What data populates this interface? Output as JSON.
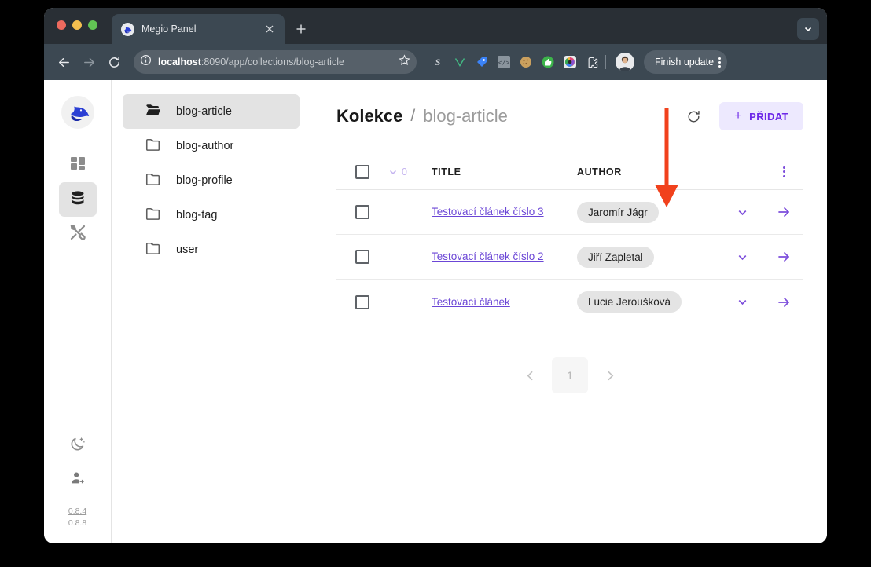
{
  "browser": {
    "tab": {
      "title": "Megio Panel",
      "favicon_icon": "shark-favicon",
      "close_icon": "close-icon"
    },
    "new_tab_label": "+",
    "tab_list_icon": "chevron-down-icon",
    "nav": {
      "back_icon": "arrow-back-icon",
      "forward_icon": "arrow-forward-icon",
      "reload_icon": "reload-icon"
    },
    "omnibox": {
      "info_icon": "info-circle-icon",
      "url_host": "localhost",
      "url_rest": ":8090/app/collections/blog-article",
      "bookmark_icon": "star-icon"
    },
    "extensions": [
      {
        "name": "grammarly-extension-icon",
        "glyph": "S",
        "color": "#c9ced3"
      },
      {
        "name": "vue-devtools-extension-icon",
        "glyph": "V",
        "color": "#42b883"
      },
      {
        "name": "tag-extension-icon",
        "glyph": "◈",
        "color": "#3b82f6"
      },
      {
        "name": "code-extension-icon",
        "glyph": "</>",
        "color": "#3a4a57"
      },
      {
        "name": "cookie-extension-icon",
        "glyph": "●",
        "color": "#c99553"
      },
      {
        "name": "thumbs-up-extension-icon",
        "glyph": "👍",
        "color": "#3cb44a"
      },
      {
        "name": "colorwheel-extension-icon",
        "glyph": "◎",
        "color": "#e0457b"
      },
      {
        "name": "puzzle-extensions-icon",
        "glyph": "⬒",
        "color": "#e8eaed"
      }
    ],
    "profile": {
      "avatar_icon": "user-avatar"
    },
    "update_button": {
      "label": "Finish update",
      "menu_icon": "kebab-menu-icon"
    }
  },
  "rail": {
    "logo_icon": "megio-shark-logo",
    "items": [
      {
        "name": "dashboard",
        "icon": "grid-dashboard-icon",
        "active": false
      },
      {
        "name": "collections",
        "icon": "database-icon",
        "active": true
      },
      {
        "name": "tools",
        "icon": "tools-icon",
        "active": false
      }
    ],
    "bottom_items": [
      {
        "name": "dark-mode",
        "icon": "moon-icon"
      },
      {
        "name": "logout",
        "icon": "user-logout-icon"
      }
    ],
    "version_current": "0.8.4",
    "version_latest": "0.8.8"
  },
  "collections": {
    "items": [
      {
        "label": "blog-article",
        "icon": "folder-open-icon",
        "active": true
      },
      {
        "label": "blog-author",
        "icon": "folder-icon",
        "active": false
      },
      {
        "label": "blog-profile",
        "icon": "folder-icon",
        "active": false
      },
      {
        "label": "blog-tag",
        "icon": "folder-icon",
        "active": false
      },
      {
        "label": "user",
        "icon": "folder-icon",
        "active": false
      }
    ]
  },
  "main": {
    "breadcrumb_root": "Kolekce",
    "breadcrumb_separator": "/",
    "breadcrumb_current": "blog-article",
    "refresh_icon": "refresh-icon",
    "add_button": {
      "plus": "+",
      "label": "PŘIDAT"
    },
    "table": {
      "select_all_icon": "checkbox-unchecked-icon",
      "selection_chevron_icon": "chevron-down-icon",
      "selection_count": "0",
      "columns": [
        "TITLE",
        "AUTHOR"
      ],
      "options_icon": "kebab-menu-icon",
      "rows": [
        {
          "checkbox_icon": "checkbox-unchecked-icon",
          "title": "Testovací článek číslo 3",
          "author": "Jaromír Jágr",
          "expand_icon": "chevron-down-icon",
          "open_icon": "arrow-right-icon"
        },
        {
          "checkbox_icon": "checkbox-unchecked-icon",
          "title": "Testovací článek číslo 2",
          "author": "Jiří Zapletal",
          "expand_icon": "chevron-down-icon",
          "open_icon": "arrow-right-icon"
        },
        {
          "checkbox_icon": "checkbox-unchecked-icon",
          "title": "Testovací článek",
          "author": "Lucie Jeroušková",
          "expand_icon": "chevron-down-icon",
          "open_icon": "arrow-right-icon"
        }
      ]
    },
    "pagination": {
      "prev_icon": "chevron-left-icon",
      "page": "1",
      "next_icon": "chevron-right-icon"
    }
  },
  "annotation": {
    "arrow_icon": "red-down-arrow-annotation",
    "color": "#f1411c"
  },
  "colors": {
    "accent_purple": "#6d28e8",
    "accent_purple_soft": "#ede9fe",
    "link_purple": "#6b46d6",
    "chrome_tabstrip": "#292f35",
    "chrome_toolbar": "#3c4852",
    "pill_grey": "#e4e4e4"
  }
}
